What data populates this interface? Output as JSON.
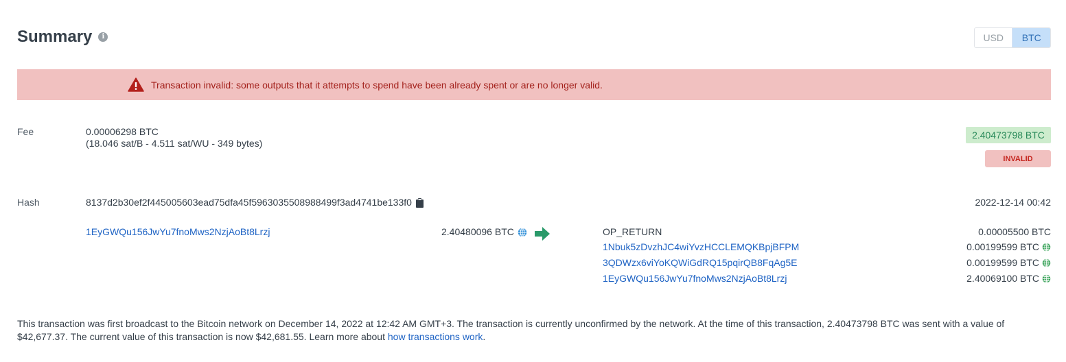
{
  "summary": {
    "title": "Summary",
    "info_icon": "info-icon"
  },
  "currency_toggle": {
    "options": [
      "USD",
      "BTC"
    ],
    "selected": "BTC"
  },
  "alert": {
    "message": "Transaction invalid: some outputs that it attempts to spend have been already spent or are no longer valid.",
    "icon": "warning-icon"
  },
  "fee": {
    "label": "Fee",
    "amount": "0.00006298 BTC",
    "details": "(18.046 sat/B - 4.511 sat/WU - 349 bytes)"
  },
  "total": {
    "amount": "2.40473798 BTC",
    "status": "INVALID"
  },
  "hash": {
    "label": "Hash",
    "value": "8137d2b30ef2f445005603ead75dfa45f5963035508988499f3ad4741be133f0",
    "date": "2022-12-14 00:42"
  },
  "input": {
    "address": "1EyGWQu156JwYu7fnoMws2NzjAoBt8Lrzj",
    "amount": "2.40480096 BTC"
  },
  "outputs": [
    {
      "address": "OP_RETURN",
      "amount": "0.00005500 BTC",
      "is_link": false,
      "has_globe": false
    },
    {
      "address": "1Nbuk5zDvzhJC4wiYvzHCCLEMQKBpjBFPM",
      "amount": "0.00199599 BTC",
      "is_link": true,
      "has_globe": true
    },
    {
      "address": "3QDWzx6viYoKQWiGdRQ15pqirQB8FqAg5E",
      "amount": "0.00199599 BTC",
      "is_link": true,
      "has_globe": true
    },
    {
      "address": "1EyGWQu156JwYu7fnoMws2NzjAoBt8Lrzj",
      "amount": "2.40069100 BTC",
      "is_link": true,
      "has_globe": true
    }
  ],
  "footer": {
    "text": "This transaction was first broadcast to the Bitcoin network on December 14, 2022 at 12:42 AM GMT+3.  The transaction is currently unconfirmed by the network.  At the time of this transaction, 2.40473798 BTC was sent with a value of $42,677.37. The current value of this transaction is now $42,681.55.  Learn more about ",
    "link_text": "how transactions work",
    "trailing": "."
  },
  "colors": {
    "link": "#1e63c4",
    "alert_bg": "#f1c1c0",
    "alert_text": "#a3211c",
    "success_bg": "#cdeccd",
    "success_text": "#2a8a5a",
    "arrow": "#2a9a6a",
    "globe": "#3aa35a"
  }
}
